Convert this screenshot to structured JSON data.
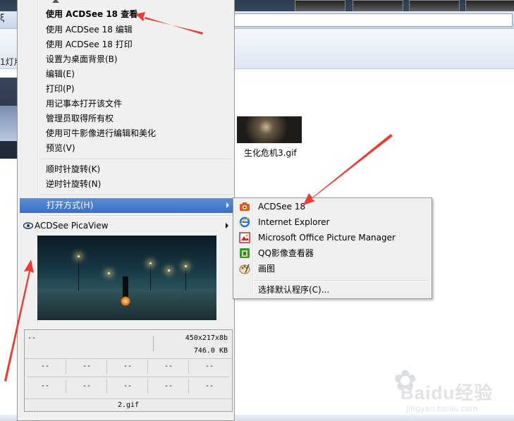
{
  "background": {
    "nav_fragment": "ξ",
    "toolbar_fragment": "1灯片",
    "file": {
      "name": "生化危机3.gif"
    }
  },
  "context_menu": {
    "items": [
      {
        "label": "使用 ACDSee 18 查看",
        "bold": true
      },
      {
        "label": "使用 ACDSee 18 编辑"
      },
      {
        "label": "使用 ACDSee 18 打印"
      },
      {
        "label": "设置为桌面背景(B)"
      },
      {
        "label": "编辑(E)"
      },
      {
        "label": "打印(P)"
      },
      {
        "label": "用记事本打开该文件"
      },
      {
        "label": "管理员取得所有权"
      },
      {
        "label": "使用可牛影像进行编辑和美化"
      },
      {
        "label": "预览(V)"
      }
    ],
    "rotate": [
      {
        "label": "顺时针旋转(K)"
      },
      {
        "label": "逆时针旋转(N)"
      }
    ],
    "open_with": {
      "label": "打开方式(H)"
    },
    "picaview": {
      "label": "ACDSee PicaView",
      "info": {
        "left": "--",
        "dimensions": "450x217x8b",
        "size": "746.0 KB",
        "grid": [
          "--",
          "--",
          "--",
          "--",
          "--",
          "--",
          "--",
          "--",
          "--",
          "--"
        ],
        "filename": "2.gif"
      }
    }
  },
  "submenu": {
    "items": [
      {
        "label": "ACDSee 18",
        "icon": "acdsee-icon",
        "color": "#e05a1a"
      },
      {
        "label": "Internet Explorer",
        "icon": "internet-explorer-icon",
        "color": "#1e78d6"
      },
      {
        "label": "Microsoft Office Picture Manager",
        "icon": "picture-manager-icon",
        "color": "#c03030"
      },
      {
        "label": "QQ影像查看器",
        "icon": "qq-image-viewer-icon",
        "color": "#2a9a3a"
      },
      {
        "label": "画图",
        "icon": "paint-icon",
        "color": "#3a7bd5"
      }
    ],
    "default_program": {
      "label": "选择默认程序(C)..."
    }
  },
  "watermark": {
    "brand": "Baidu经验",
    "url": "jingyan.baidu.com"
  },
  "colors": {
    "highlight": "#3b6fc6",
    "annotation": "#ee3a32"
  }
}
